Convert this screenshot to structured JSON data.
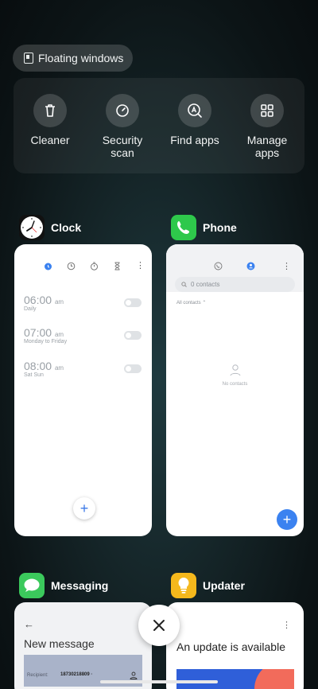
{
  "floating_windows": {
    "label": "Floating windows"
  },
  "quick_actions": [
    {
      "label": "Cleaner",
      "icon": "trash-icon"
    },
    {
      "label": "Security\nscan",
      "icon": "security-scan-icon"
    },
    {
      "label": "Find apps",
      "icon": "find-apps-icon"
    },
    {
      "label": "Manage\napps",
      "icon": "grid-icon"
    }
  ],
  "apps": {
    "clock": {
      "name": "Clock",
      "alarms": [
        {
          "time": "06:00",
          "period": "am",
          "repeat": "Daily"
        },
        {
          "time": "07:00",
          "period": "am",
          "repeat": "Monday to Friday"
        },
        {
          "time": "08:00",
          "period": "am",
          "repeat": "Sat Sun"
        }
      ]
    },
    "phone": {
      "name": "Phone",
      "search_placeholder": "0 contacts",
      "filter": "All contacts",
      "empty_text": "No contacts"
    },
    "messaging": {
      "name": "Messaging",
      "title": "New message",
      "recipient_label": "Recipient:",
      "recipient_value": "18730218809 ·"
    },
    "updater": {
      "name": "Updater",
      "headline": "An update is available"
    }
  },
  "colors": {
    "accent": "#3b82f0",
    "phone_green": "#2ec84b",
    "updater_yellow": "#f5b81c"
  }
}
